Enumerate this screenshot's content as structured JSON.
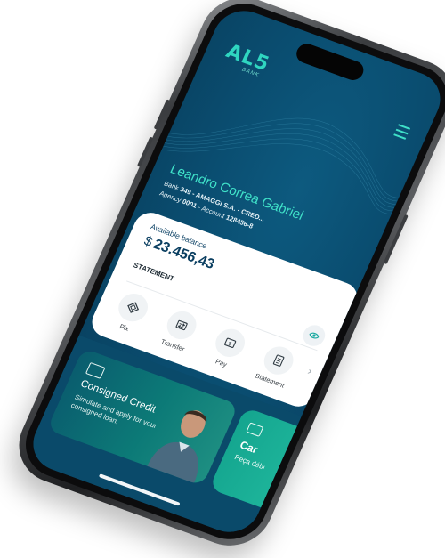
{
  "app": {
    "logo_text": "AL5",
    "logo_sub": "BANK"
  },
  "header": {
    "menu_icon": "hamburger-menu-icon"
  },
  "user": {
    "name": "Leandro Correa Gabriel",
    "bank_label": "Bank",
    "bank_value": "349 - AMAGGI S.A. - CRED...",
    "agency_label": "Agency",
    "agency_value": "0001",
    "account_label": "Account",
    "account_value": "128456-8"
  },
  "balance": {
    "label": "Available balance",
    "currency": "$",
    "amount": "23.456,43"
  },
  "statement": {
    "label": "STATEMENT"
  },
  "actions": [
    {
      "label": "Pix",
      "icon": "pix-icon"
    },
    {
      "label": "Transfer",
      "icon": "transfer-icon"
    },
    {
      "label": "Pay",
      "icon": "pay-icon"
    },
    {
      "label": "Statement",
      "icon": "statement-icon"
    }
  ],
  "promo": {
    "title": "Consigned Credit",
    "text": "Simulate and apply for your consigned loan.",
    "icon": "consigned-credit-icon"
  },
  "promo2": {
    "title": "Car",
    "text": "Peça débi",
    "icon": "card-icon"
  },
  "colors": {
    "screen_bg": "#0a4d70",
    "accent": "#2fd6c0",
    "card_bg": "#ffffff",
    "promo_start": "#0a5c6e",
    "promo2": "#14a58f"
  }
}
